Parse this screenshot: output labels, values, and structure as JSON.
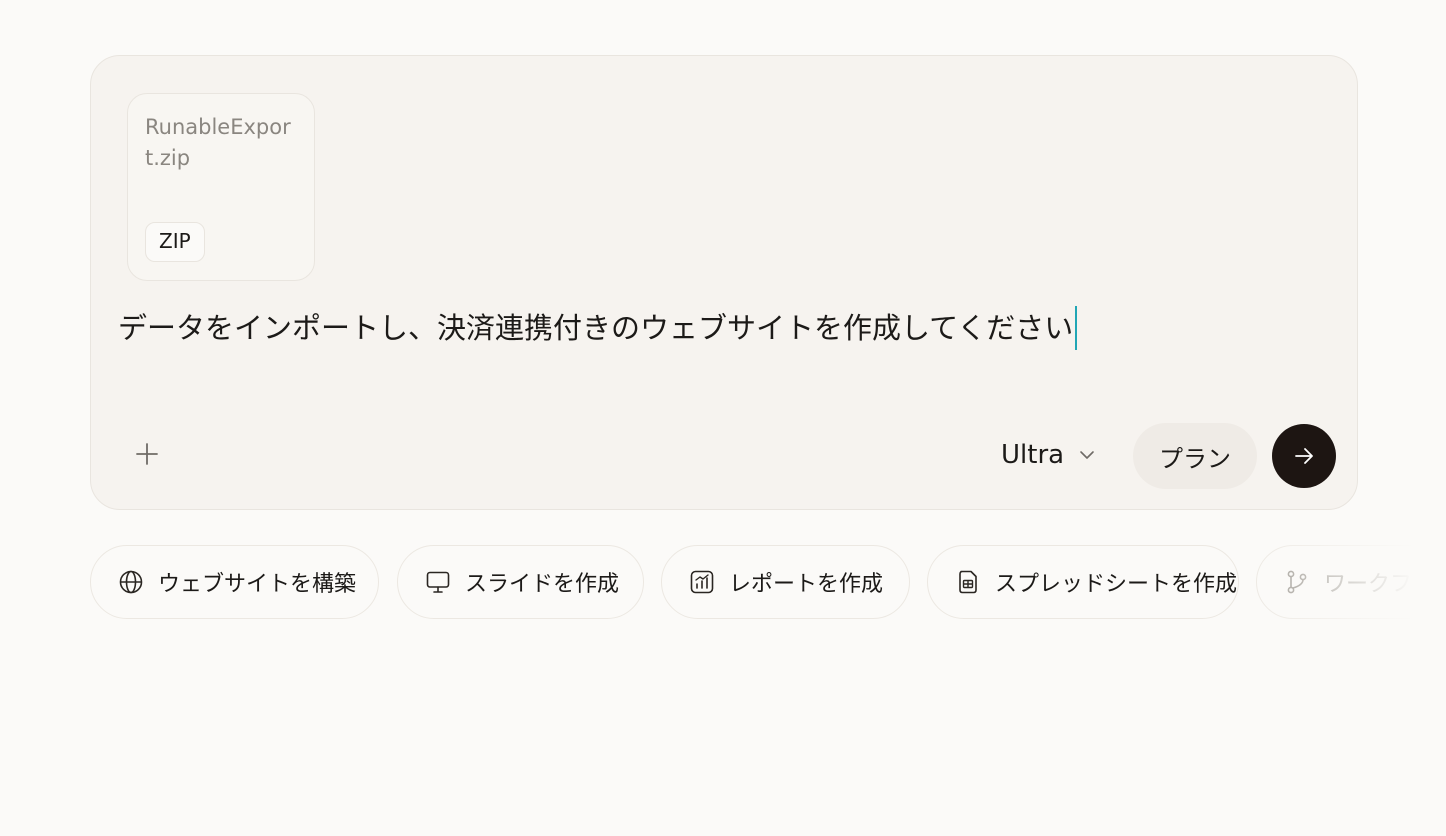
{
  "composer": {
    "attachment": {
      "file_name": "RunableExport.zip",
      "file_type": "ZIP"
    },
    "prompt_text": "データをインポートし、決済連携付きのウェブサイトを作成してください",
    "model": "Ultra",
    "plan_label": "プラン"
  },
  "suggestions": [
    {
      "label": "ウェブサイトを構築",
      "icon": "globe-icon"
    },
    {
      "label": "スライドを作成",
      "icon": "presentation-icon"
    },
    {
      "label": "レポートを作成",
      "icon": "chart-report-icon"
    },
    {
      "label": "スプレッドシートを作成",
      "icon": "spreadsheet-icon"
    },
    {
      "label": "ワークフロー",
      "icon": "workflow-icon"
    }
  ],
  "colors": {
    "caret": "#21a6b5",
    "send_button": "#1d1512",
    "background": "#fbfaf8"
  }
}
